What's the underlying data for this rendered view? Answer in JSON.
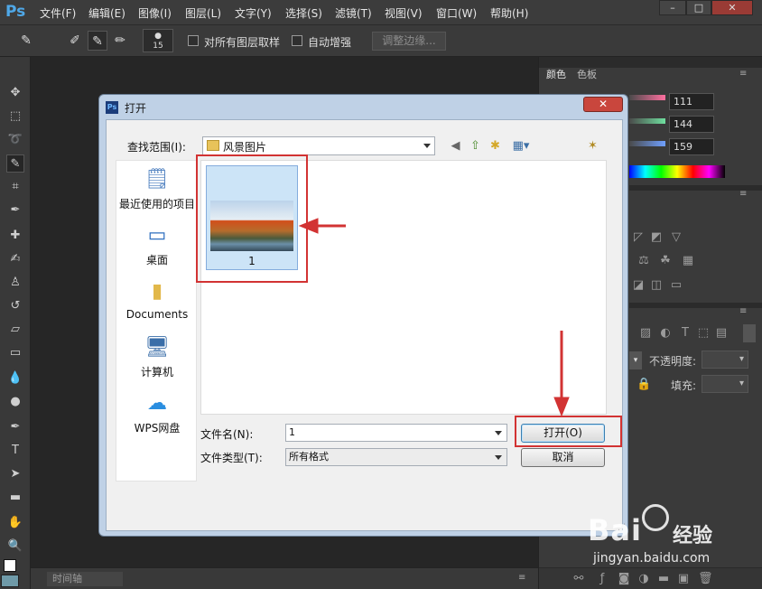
{
  "app": {
    "logo": "Ps",
    "menus": [
      "文件(F)",
      "编辑(E)",
      "图像(I)",
      "图层(L)",
      "文字(Y)",
      "选择(S)",
      "滤镜(T)",
      "视图(V)",
      "窗口(W)",
      "帮助(H)"
    ],
    "window_buttons": [
      "–",
      "□",
      "✕"
    ]
  },
  "options": {
    "brush_size": "15",
    "sample_all_layers": "对所有图层取样",
    "auto_enhance": "自动增强",
    "refine_edge": "调整边缘..."
  },
  "timeline": {
    "tab": "时间轴"
  },
  "panels": {
    "color_tabs": [
      "颜色",
      "色板"
    ],
    "rgb": [
      "111",
      "144",
      "159"
    ],
    "opacity_label": "不透明度:",
    "fill_label": "填充:"
  },
  "dialog": {
    "title": "打开",
    "close": "✕",
    "look_in_label": "查找范围(I):",
    "look_in_value": "风景图片",
    "places": [
      "最近使用的项目",
      "桌面",
      "Documents",
      "计算机",
      "WPS网盘"
    ],
    "files": [
      {
        "name": "1"
      }
    ],
    "filename_label": "文件名(N):",
    "filename_value": "1",
    "filetype_label": "文件类型(T):",
    "filetype_value": "所有格式",
    "open_button": "打开(O)",
    "cancel_button": "取消"
  },
  "watermark": {
    "brand": "Bai",
    "brand2": "经验",
    "url": "jingyan.baidu.com"
  },
  "colors": {
    "annotation": "#d23333",
    "ps_blue": "#4fa8e8"
  }
}
